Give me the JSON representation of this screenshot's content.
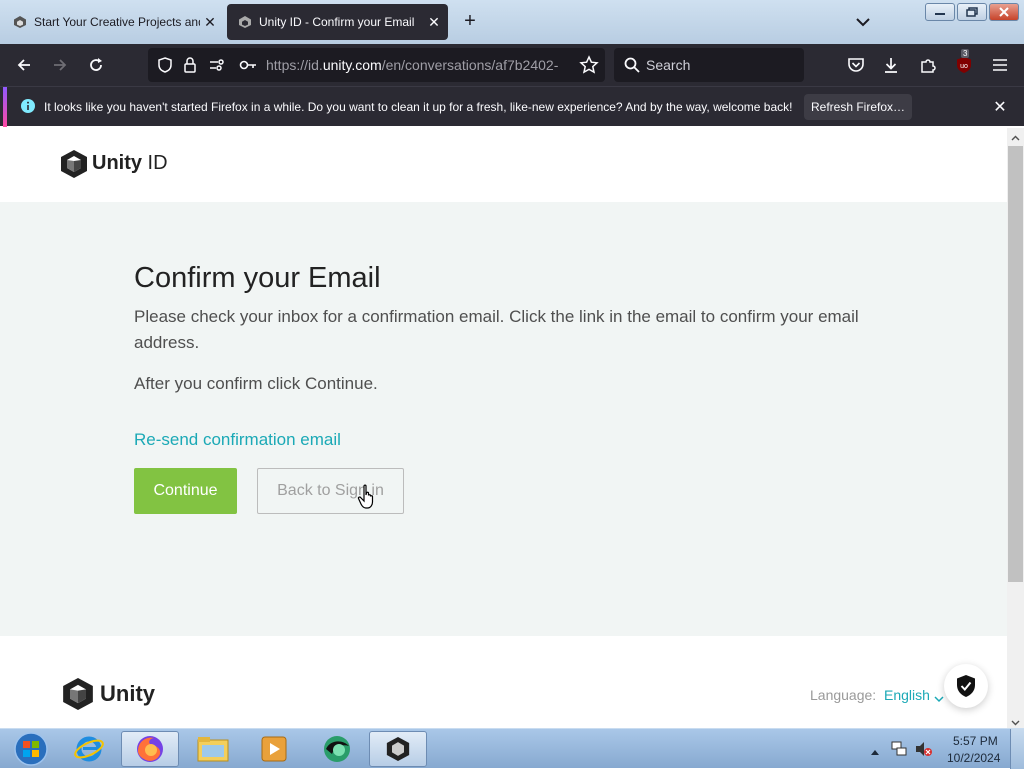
{
  "browser": {
    "tabs": [
      {
        "title": "Start Your Creative Projects and",
        "active": false
      },
      {
        "title": "Unity ID - Confirm your Email",
        "active": true
      }
    ],
    "url_prefix": "https://id.",
    "url_domain": "unity.com",
    "url_path": "/en/conversations/af7b2402-",
    "search_placeholder": "Search",
    "extension_badge": "3",
    "notification": {
      "message": "It looks like you haven't started Firefox in a while. Do you want to clean it up for a fresh, like-new experience? And by the way, welcome back!",
      "button_label": "Refresh Firefox…"
    }
  },
  "page": {
    "brand": {
      "bold": "Unity",
      "suffix": " ID"
    },
    "heading": "Confirm your Email",
    "paragraph1": "Please check your inbox for a confirmation email. Click the link in the email to confirm your email address.",
    "paragraph2": "After you confirm click Continue.",
    "resend_link": "Re-send confirmation email",
    "continue_label": "Continue",
    "back_label": "Back to Sign in",
    "footer_brand": "Unity",
    "language_label": "Language:",
    "language_value": "English",
    "accent_color": "#82c342",
    "link_color": "#1ba9b6"
  },
  "taskbar": {
    "time": "5:57 PM",
    "date": "10/2/2024"
  }
}
